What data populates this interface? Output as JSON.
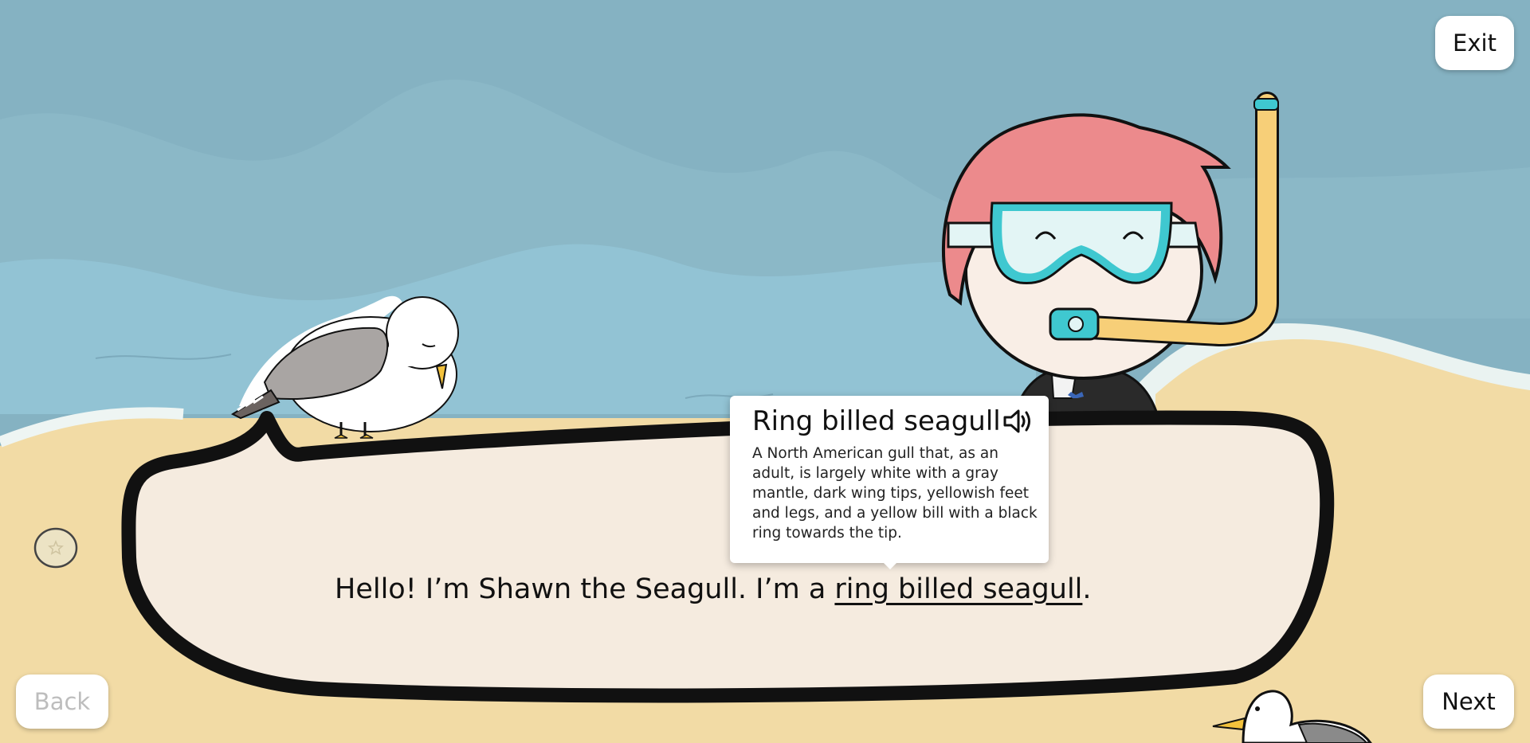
{
  "controls": {
    "exit_label": "Exit",
    "back_label": "Back",
    "next_label": "Next"
  },
  "dialog": {
    "prefix": "Hello! I’m Shawn the Seagull. I’m a ",
    "term": "ring billed seagull",
    "suffix": "."
  },
  "definition_popup": {
    "title": "Ring billed seagull",
    "definition": "A North American gull that, as an adult, is largely white with a gray mantle, dark wing tips, yellowish feet and legs, and a yellow bill with a black ring towards the tip.",
    "audio_icon": "speaker-icon"
  },
  "colors": {
    "sky": "#85b2c2",
    "water": "#93c2d3",
    "sand": "#f2dba5",
    "bubble_fill": "#f5ebdf",
    "hair": "#ec8a8c",
    "goggles": "#3fc8d0",
    "snorkel": "#f7cf78"
  }
}
